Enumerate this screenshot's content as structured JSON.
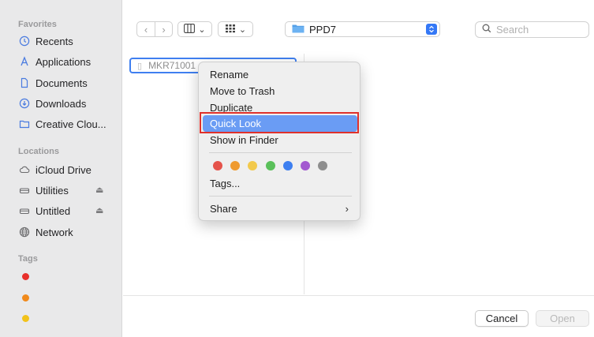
{
  "sidebar": {
    "favorites_header": "Favorites",
    "favorites": [
      {
        "label": "Recents",
        "icon": "clock-icon"
      },
      {
        "label": "Applications",
        "icon": "applications-icon"
      },
      {
        "label": "Documents",
        "icon": "document-icon"
      },
      {
        "label": "Downloads",
        "icon": "download-icon"
      },
      {
        "label": "Creative Clou...",
        "icon": "folder-icon"
      }
    ],
    "locations_header": "Locations",
    "locations": [
      {
        "label": "iCloud Drive",
        "icon": "cloud-icon"
      },
      {
        "label": "Utilities",
        "icon": "drive-icon",
        "eject": "⏏"
      },
      {
        "label": "Untitled",
        "icon": "drive-icon",
        "eject": "⏏"
      },
      {
        "label": "Network",
        "icon": "globe-icon"
      }
    ],
    "tags_header": "Tags",
    "tag_colors": [
      "#e8302b",
      "#f08a1c",
      "#f2c21a"
    ]
  },
  "toolbar": {
    "back_glyph": "‹",
    "forward_glyph": "›",
    "column_view_chevron": "⌄",
    "grid_view_chevron": "⌄",
    "location": "PPD7",
    "search_placeholder": "Search"
  },
  "browser": {
    "selected_file": "MKR71001"
  },
  "context_menu": {
    "items": [
      {
        "label": "Rename"
      },
      {
        "label": "Move to Trash"
      },
      {
        "label": "Duplicate"
      },
      {
        "label": "Quick Look",
        "highlighted": true
      },
      {
        "label": "Show in Finder"
      }
    ],
    "tag_colors": [
      "#e5534b",
      "#ef9a2f",
      "#f2c94c",
      "#5ac05a",
      "#3d7ff0",
      "#a359d0",
      "#8e8e8e"
    ],
    "tags_label": "Tags...",
    "share_label": "Share",
    "share_chevron": "›"
  },
  "footer": {
    "cancel_label": "Cancel",
    "open_label": "Open"
  },
  "colors": {
    "accent": "#3478f6",
    "highlight": "#6a9cf4",
    "annotation_red": "#e0312b"
  }
}
